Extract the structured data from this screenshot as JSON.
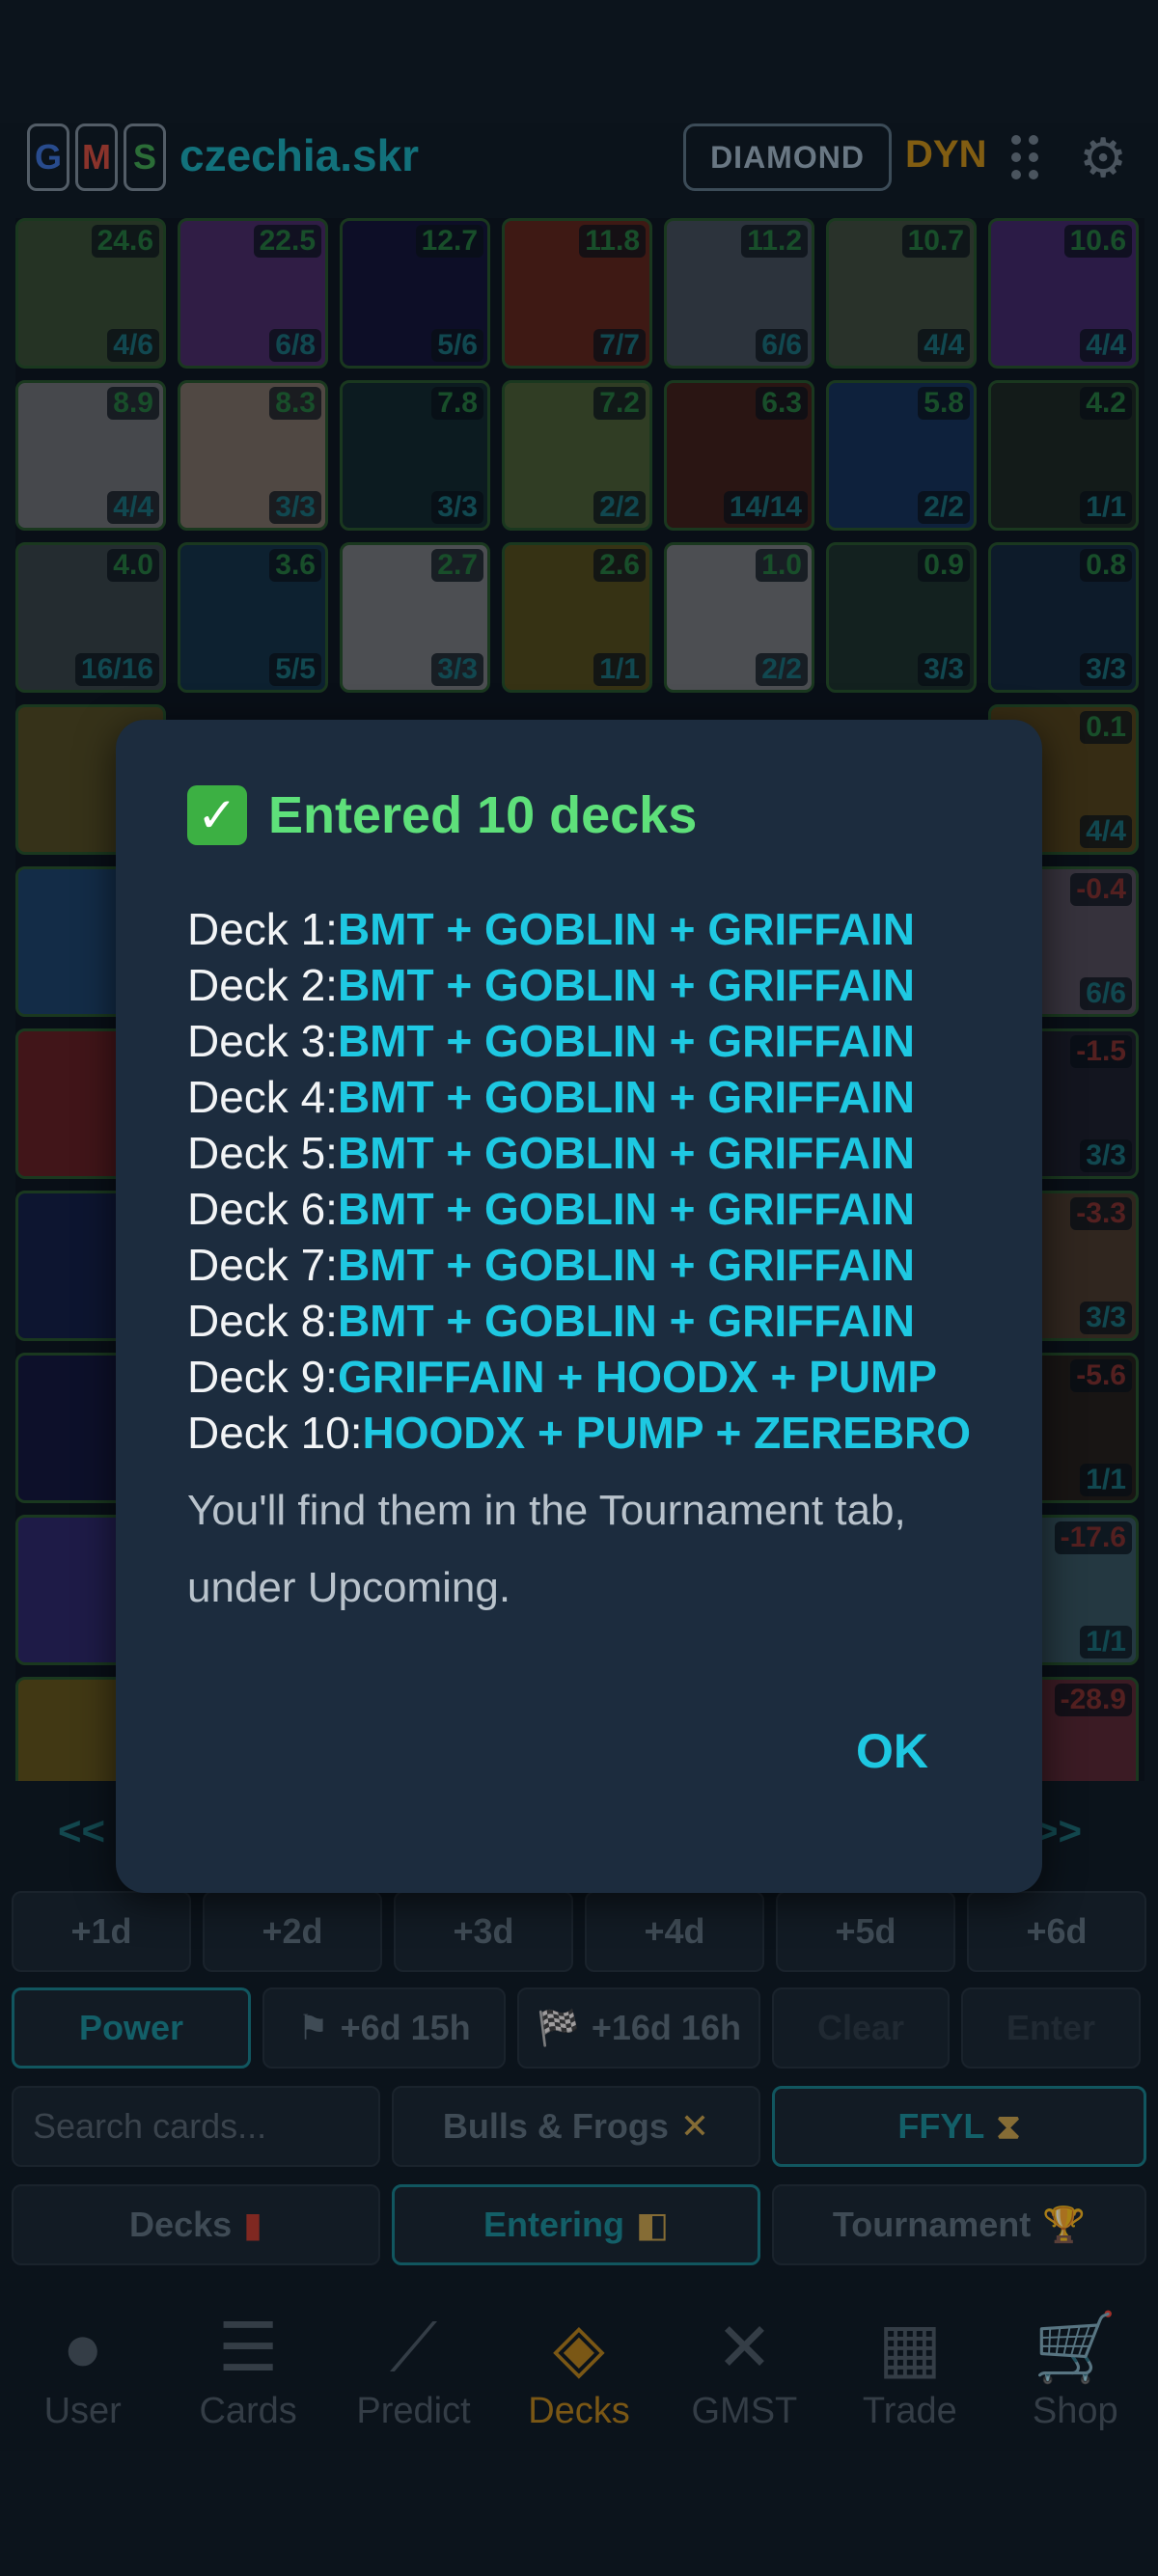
{
  "header": {
    "gms": [
      "G",
      "M",
      "S"
    ],
    "gms_colors": [
      "#3b6fd1",
      "#d14a3b",
      "#3fa34d"
    ],
    "brand": "czechia.skr",
    "tier": "DIAMOND",
    "currency": "DYN",
    "menu_icon": "grid-dots-icon",
    "settings_icon": "gear-icon"
  },
  "cards": [
    {
      "score": "24.6",
      "count": "4/6",
      "color": "#5b7d4a"
    },
    {
      "score": "22.5",
      "count": "6/8",
      "color": "#7a3ea5"
    },
    {
      "score": "12.7",
      "count": "5/6",
      "color": "#1a1650"
    },
    {
      "score": "11.8",
      "count": "7/7",
      "color": "#a2331c"
    },
    {
      "score": "11.2",
      "count": "6/6",
      "color": "#6f7c8a"
    },
    {
      "score": "10.7",
      "count": "4/4",
      "color": "#667a5a"
    },
    {
      "score": "10.6",
      "count": "4/4",
      "color": "#6d39a8"
    },
    {
      "score": "8.9",
      "count": "4/4",
      "color": "#b9b9b9"
    },
    {
      "score": "8.3",
      "count": "3/3",
      "color": "#d4b89e"
    },
    {
      "score": "7.8",
      "count": "3/3",
      "color": "#173a3c"
    },
    {
      "score": "7.2",
      "count": "2/2",
      "color": "#7a9a4a"
    },
    {
      "score": "6.3",
      "count": "14/14",
      "color": "#6a2a18"
    },
    {
      "score": "5.8",
      "count": "2/2",
      "color": "#1d4a8a"
    },
    {
      "score": "4.2",
      "count": "1/1",
      "color": "#2b3a2a"
    },
    {
      "score": "4.0",
      "count": "16/16",
      "color": "#5a6a6a"
    },
    {
      "score": "3.6",
      "count": "5/5",
      "color": "#1a4a6a"
    },
    {
      "score": "2.7",
      "count": "3/3",
      "color": "#c9c9c9"
    },
    {
      "score": "2.6",
      "count": "1/1",
      "color": "#8a7a1a"
    },
    {
      "score": "1.0",
      "count": "2/2",
      "color": "#c9c9c9"
    },
    {
      "score": "0.9",
      "count": "3/3",
      "color": "#2a4a3a"
    },
    {
      "score": "0.8",
      "count": "3/3",
      "color": "#1a3a5a"
    }
  ],
  "right_cards": [
    {
      "score": "0.1",
      "count": "4/4",
      "color": "#8a6a1a"
    },
    {
      "score": "-0.4",
      "count": "6/6",
      "color": "#8a7a8a"
    },
    {
      "score": "-1.5",
      "count": "3/3",
      "color": "#2a2a3a"
    },
    {
      "score": "-3.3",
      "count": "3/3",
      "color": "#7a5a3a"
    },
    {
      "score": "-5.6",
      "count": "1/1",
      "color": "#3a2a1a"
    },
    {
      "score": "-17.6",
      "count": "1/1",
      "color": "#5a8a9a"
    },
    {
      "score": "-28.9",
      "count": "",
      "color": "#9a3a4a"
    }
  ],
  "left_cards": [
    "#8a7a2a",
    "#2a6aaa",
    "#aa2a2a",
    "#1a2a6a",
    "#1a1a5a",
    "#4a3aaa",
    "#aa8a1a"
  ],
  "pager": {
    "prev": "<<",
    "next": ">>"
  },
  "day_buttons": [
    "+1d",
    "+2d",
    "+3d",
    "+4d",
    "+5d",
    "+6d"
  ],
  "actions": {
    "power": "Power",
    "flag1": "+6d 15h",
    "flag2": "+16d 16h",
    "clear": "Clear",
    "enter": "Enter"
  },
  "filters": {
    "search_placeholder": "Search cards...",
    "mode": "Bulls & Frogs",
    "ffyl": "FFYL"
  },
  "tabs": {
    "decks": "Decks",
    "entering": "Entering",
    "tournament": "Tournament"
  },
  "nav": [
    {
      "label": "User",
      "icon": "user-icon",
      "glyph": "●"
    },
    {
      "label": "Cards",
      "icon": "list-icon",
      "glyph": "☰"
    },
    {
      "label": "Predict",
      "icon": "chart-line-icon",
      "glyph": "⟋"
    },
    {
      "label": "Decks",
      "icon": "layers-icon",
      "glyph": "◈"
    },
    {
      "label": "GMST",
      "icon": "swords-icon",
      "glyph": "✕"
    },
    {
      "label": "Trade",
      "icon": "store-icon",
      "glyph": "▦"
    },
    {
      "label": "Shop",
      "icon": "cart-icon",
      "glyph": "🛒"
    }
  ],
  "dialog": {
    "title": "Entered 10 decks",
    "decks": [
      {
        "label": "Deck 1:",
        "value": "BMT + GOBLIN + GRIFFAIN"
      },
      {
        "label": "Deck 2:",
        "value": "BMT + GOBLIN + GRIFFAIN"
      },
      {
        "label": "Deck 3:",
        "value": "BMT + GOBLIN + GRIFFAIN"
      },
      {
        "label": "Deck 4:",
        "value": "BMT + GOBLIN + GRIFFAIN"
      },
      {
        "label": "Deck 5:",
        "value": "BMT + GOBLIN + GRIFFAIN"
      },
      {
        "label": "Deck 6:",
        "value": "BMT + GOBLIN + GRIFFAIN"
      },
      {
        "label": "Deck 7:",
        "value": "BMT + GOBLIN + GRIFFAIN"
      },
      {
        "label": "Deck 8:",
        "value": "BMT + GOBLIN + GRIFFAIN"
      },
      {
        "label": "Deck 9:",
        "value": "GRIFFAIN + HOODX + PUMP"
      },
      {
        "label": "Deck 10:",
        "value": "HOODX + PUMP + ZEREBRO"
      }
    ],
    "message": "You'll find them in the Tournament tab, under Upcoming.",
    "ok": "OK"
  }
}
